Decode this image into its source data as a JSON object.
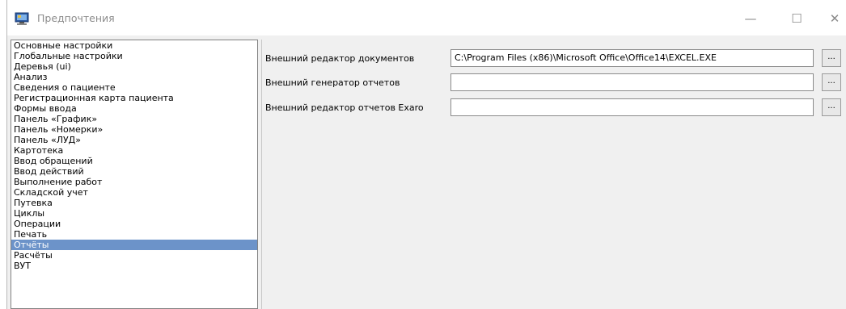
{
  "window": {
    "title": "Предпочтения",
    "controls": {
      "minimize": "—",
      "maximize": "☐",
      "close": "✕"
    }
  },
  "sidebar": {
    "items": [
      {
        "label": "Основные настройки"
      },
      {
        "label": "Глобальные настройки"
      },
      {
        "label": "Деревья (ui)"
      },
      {
        "label": "Анализ"
      },
      {
        "label": "Сведения о пациенте"
      },
      {
        "label": "Регистрационная карта пациента"
      },
      {
        "label": "Формы ввода"
      },
      {
        "label": "Панель «График»"
      },
      {
        "label": "Панель «Номерки»"
      },
      {
        "label": "Панель «ЛУД»"
      },
      {
        "label": "Картотека"
      },
      {
        "label": "Ввод обращений"
      },
      {
        "label": "Ввод действий"
      },
      {
        "label": "Выполнение работ"
      },
      {
        "label": "Складской учет"
      },
      {
        "label": "Путевка"
      },
      {
        "label": "Циклы"
      },
      {
        "label": "Операции"
      },
      {
        "label": "Печать"
      },
      {
        "label": "Отчёты",
        "selected": true
      },
      {
        "label": "Расчёты"
      },
      {
        "label": "ВУТ"
      }
    ]
  },
  "settings": {
    "rows": [
      {
        "label": "Внешний редактор документов",
        "value": "C:\\Program Files (x86)\\Microsoft Office\\Office14\\EXCEL.EXE",
        "browse": "..."
      },
      {
        "label": "Внешний генератор отчетов",
        "value": "",
        "browse": "..."
      },
      {
        "label": "Внешний редактор отчетов Exaro",
        "value": "",
        "browse": "..."
      }
    ]
  },
  "colors": {
    "selection": "#6c93c9",
    "window_bg": "#f0f0f0"
  }
}
